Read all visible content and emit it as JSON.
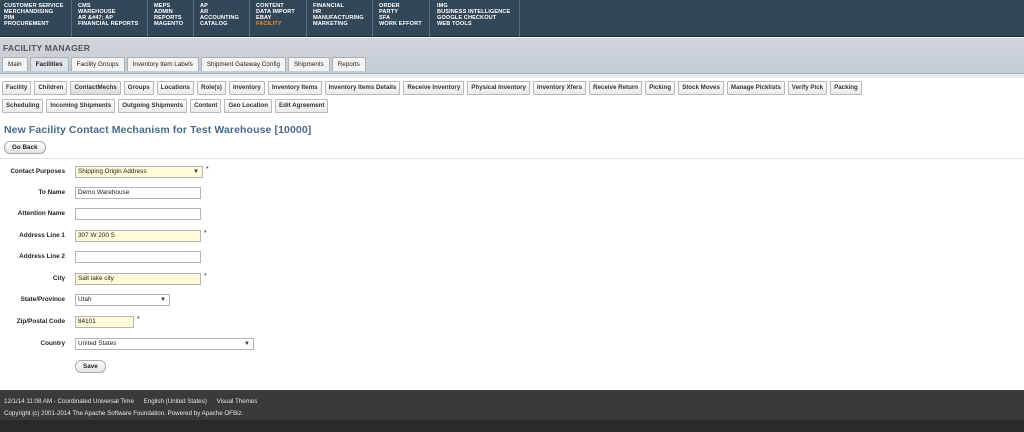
{
  "top_menu": [
    [
      "CUSTOMER SERVICE",
      "MERCHANDISING",
      "PIM",
      "PROCUREMENT"
    ],
    [
      "CMS",
      "WAREHOUSE",
      "AR &#47; AP",
      "FINANCIAL REPORTS"
    ],
    [
      "MEPS",
      "ADMIN",
      "REPORTS",
      "MAGENTO"
    ],
    [
      "AP",
      "AR",
      "ACCOUNTING",
      "CATALOG"
    ],
    [
      "CONTENT",
      "DATA IMPORT",
      "EBAY",
      "FACILITY"
    ],
    [
      "FINANCIAL",
      "HR",
      "MANUFACTURING",
      "MARKETING"
    ],
    [
      "ORDER",
      "PARTY",
      "SFA",
      "WORK EFFORT"
    ],
    [
      "IMG",
      "BUSINESS INTELLIGENCE",
      "GOOGLE CHECKOUT",
      "WEB TOOLS"
    ]
  ],
  "active_menu_item": "FACILITY",
  "app_title": "FACILITY MANAGER",
  "app_tabs": [
    "Main",
    "Facilities",
    "Facility Groups",
    "Inventory Item Labels",
    "Shipment Gateway Config",
    "Shipments",
    "Reports"
  ],
  "selected_app_tab": "Facilities",
  "subnav_row1": [
    "Facility",
    "Children",
    "ContactMechs",
    "Groups",
    "Locations",
    "Role(s)",
    "Inventory",
    "Inventory Items",
    "Inventory Items Details",
    "Receive Inventory",
    "Physical Inventory",
    "Inventory Xfers",
    "Receive Return",
    "Picking",
    "Stock Moves",
    "Manage Picklists",
    "Verify Pick",
    "Packing"
  ],
  "subnav_row2": [
    "Scheduling",
    "Incoming Shipments",
    "Outgoing Shipments",
    "Content",
    "Geo Location",
    "Edit Agreement"
  ],
  "selected_subnav": "ContactMechs",
  "page_title": "New Facility Contact Mechanism for Test Warehouse [10000]",
  "go_back_label": "Go Back",
  "form": {
    "contact_purposes": {
      "label": "Contact Purposes",
      "value": "Shipping Origin Address"
    },
    "to_name": {
      "label": "To Name",
      "value": "Demo Warehouse"
    },
    "attention_name": {
      "label": "Attention Name",
      "value": ""
    },
    "address1": {
      "label": "Address Line 1",
      "value": "307 W 200 S"
    },
    "address2": {
      "label": "Address Line 2",
      "value": ""
    },
    "city": {
      "label": "City",
      "value": "Salt lake city"
    },
    "state": {
      "label": "State/Province",
      "value": "Utah"
    },
    "zip": {
      "label": "Zip/Postal Code",
      "value": "84101"
    },
    "country": {
      "label": "Country",
      "value": "United States"
    },
    "required_marker": "*",
    "save_label": "Save"
  },
  "footer": {
    "datetime": "12/1/14 11:08 AM - Coordinated Universal Time",
    "locale": "English (United States)",
    "themes": "Visual Themes",
    "copyright": "Copyright (c) 2001-2014 The Apache Software Foundation. Powered by Apache OFBiz."
  },
  "colors": {
    "topbar": "#324758",
    "active_menu": "#f28d2c",
    "title_blue": "#4a6a88",
    "required_bg": "#fffbd9",
    "footer_bg": "#3a3a3a"
  }
}
